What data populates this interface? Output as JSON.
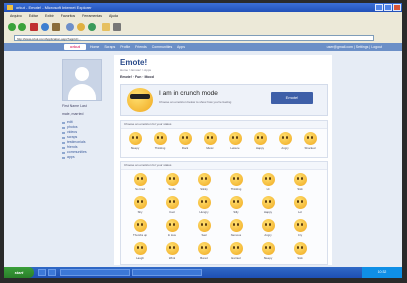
{
  "window": {
    "title": "orkut - Emote! - Microsoft Internet Explorer"
  },
  "menu": [
    "Arquivo",
    "Editar",
    "Exibir",
    "Favoritos",
    "Ferramentas",
    "Ajuda"
  ],
  "address": {
    "url": "http://www.orkut.com/Application.aspx?appId=..."
  },
  "nav": {
    "logo": "orkut",
    "links": [
      "Home",
      "Scraps",
      "Profile",
      "Friends",
      "Communities",
      "Apps"
    ],
    "right": "user@gmail.com | Settings | Logout"
  },
  "left": {
    "user_name": "First Name Last",
    "user_meta": "male, married",
    "menu": [
      "edit",
      "photos",
      "videos",
      "scraps",
      "testimonials",
      "friends",
      "communities",
      "apps"
    ]
  },
  "main": {
    "title": "Emote!",
    "crumb": "Home > Emote! > Apps",
    "sub": "Emote! · Fun · Mood",
    "hero_text": "I am in crunch mode",
    "hero_hint": "Choose an emoticon below to show how you're feeling",
    "hero_button": "Emote!",
    "sec1_title": "Choose an emoticon for your status",
    "sec1": [
      "Sleepy",
      "Thinking",
      "Rock",
      "Music",
      "Leisure",
      "Happy",
      "Angry",
      "Shocked"
    ],
    "sec2_title": "Choose an emoticon for your status",
    "sec2": [
      "So tired",
      "Smile",
      "Stinky",
      "Thinking",
      "Hi",
      "Sick",
      "Shy",
      "Cool",
      "Hungry",
      "Silly",
      "Happy",
      "Lol",
      "Thumbs up",
      "In love",
      "Sad",
      "Nervous",
      "Angry",
      "Cry",
      "Laugh",
      "Wink",
      "Bored",
      "Excited",
      "Sleepy",
      "Sick"
    ]
  },
  "taskbar": {
    "start": "start",
    "clock": "10:32"
  },
  "colors": {
    "accent": "#3e5fa8",
    "nav": "#6b8fc7",
    "brand": "#e2407a"
  }
}
